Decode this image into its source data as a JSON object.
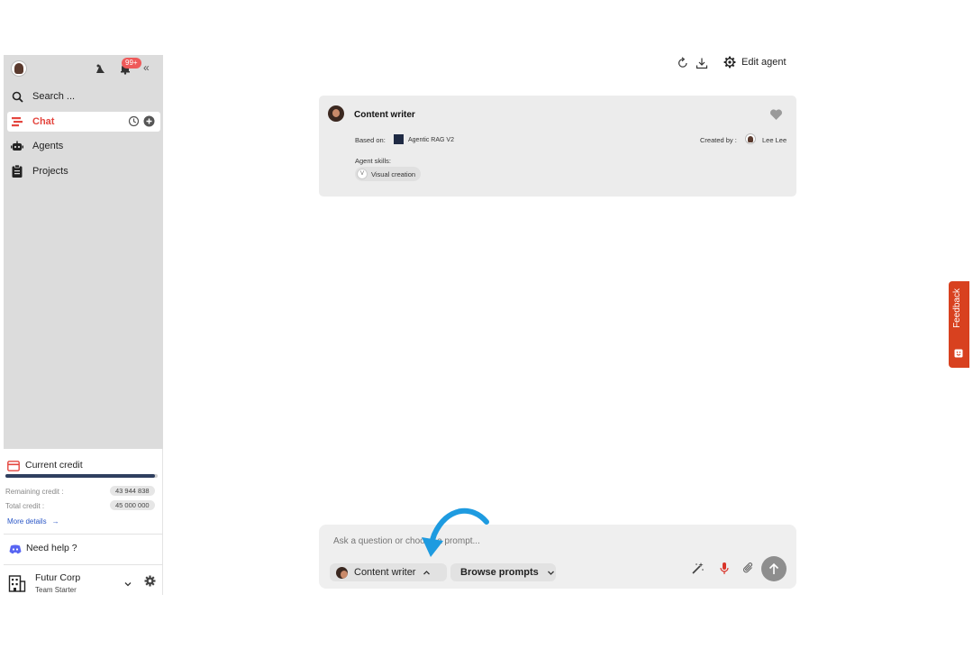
{
  "sidebar": {
    "notification_count": "99+",
    "collapse_glyph": "«",
    "search_label": "Search ...",
    "items": [
      {
        "label": "Chat",
        "icon": "chat-icon",
        "active": true
      },
      {
        "label": "Agents",
        "icon": "robot-icon"
      },
      {
        "label": "Projects",
        "icon": "clipboard-icon"
      }
    ],
    "credit": {
      "title": "Current credit",
      "progress": 0.98,
      "remaining_label": "Remaining credit :",
      "remaining_value": "43 944 838",
      "total_label": "Total credit :",
      "total_value": "45 000 000",
      "more_details": "More details"
    },
    "help_label": "Need help ?",
    "org_name": "Futur Corp",
    "org_plan": "Team Starter"
  },
  "toolbar": {
    "edit_agent_label": "Edit agent"
  },
  "agent_card": {
    "name": "Content writer",
    "based_on_label": "Based on:",
    "based_on_value": "Agentic RAG V2",
    "created_by_label": "Created by :",
    "created_by_value": "Lee Lee",
    "skills_label": "Agent skills:",
    "skill_initial": "V",
    "skill_name": "Visual creation"
  },
  "composer": {
    "placeholder": "Ask a question or choose a prompt...",
    "agent_chip_label": "Content writer",
    "browse_prompts_label": "Browse prompts"
  },
  "feedback_label": "Feedback",
  "colors": {
    "accent_red": "#e4463f",
    "credit_bar": "#2f3f5f",
    "feedback_bg": "#d8411f",
    "link_blue": "#2a56c6",
    "arrow_blue": "#1e9be0",
    "mic_red": "#d9362b"
  }
}
